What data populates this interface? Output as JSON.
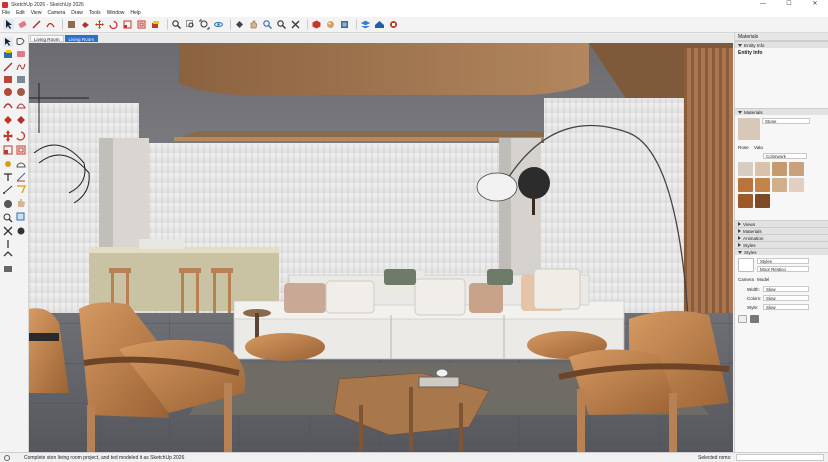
{
  "window": {
    "title": "SketchUp 2026 - SketchUp 2026",
    "minimize": "—",
    "maximize": "☐",
    "close": "✕"
  },
  "menu": [
    "File",
    "Edit",
    "View",
    "Camera",
    "Draw",
    "Tools",
    "Window",
    "Help"
  ],
  "scene_tabs": [
    {
      "label": "Living Room",
      "active": false
    },
    {
      "label": "Living Room",
      "active": true
    }
  ],
  "tray": {
    "title": "Materials",
    "entity_info": {
      "section": "Entity Info",
      "heading": "Entity Info"
    },
    "materials": {
      "section": "Materials",
      "current_name": "Stone",
      "tabs": [
        "Rose",
        "Vala"
      ],
      "category": "Colorwork",
      "swatch_colors": [
        "#d7ccc0",
        "#d9c2a8",
        "#c69a6d",
        "#c9a17c",
        "#b7743d",
        "#c2844b",
        "#d0b08a",
        "#e3cfc0",
        "#9c5a2b",
        "#7c4a27"
      ]
    },
    "collapsed_sections": [
      "Views",
      "Materials",
      "Animation",
      "Styles"
    ],
    "styles": {
      "section": "Styles",
      "style_name": "Styles",
      "style_desc": "Moor Restico",
      "camera_label": "Camera",
      "camera_value": "Model",
      "rows": [
        {
          "label": "Width:",
          "value": "Slow"
        },
        {
          "label": "Colors:",
          "value": "Slow"
        },
        {
          "label": "Style:",
          "value": "Slow"
        }
      ]
    }
  },
  "status": {
    "text": "Complete ston living room project, and ted modeled it as SketchUp 2026",
    "measure_label": "Selected roms:",
    "measure_value": ""
  }
}
